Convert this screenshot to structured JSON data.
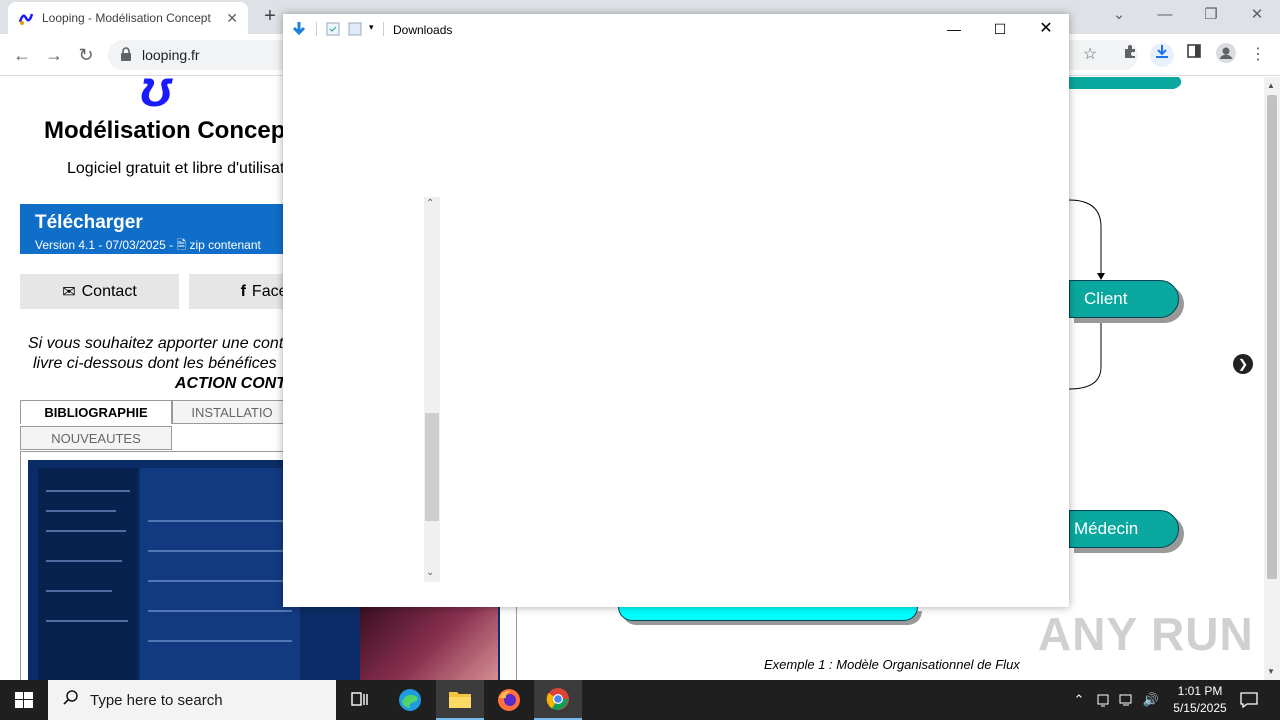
{
  "browser": {
    "tab_title": "Looping - Modélisation Concept",
    "tab_close": "✕",
    "new_tab": "+",
    "url": "looping.fr",
    "controls": {
      "collapse": "⌄",
      "minimize": "—",
      "restore": "❐",
      "close": "✕"
    }
  },
  "page": {
    "title": "Modélisation Concep",
    "subtitle": "Logiciel gratuit et libre d'utilisati",
    "download": {
      "heading": "Télécharger",
      "version_line": "Version 4.1  -  07/03/2025  -",
      "zip_text": "zip contenant"
    },
    "buttons": {
      "contact": "Contact",
      "facebook": "Faceb"
    },
    "contribution": {
      "line1": "Si vous souhaitez apporter une cont",
      "line2": "livre ci-dessous dont les bénéfices",
      "line3": "ACTION CONT"
    },
    "tabs": {
      "bibliographie": "BIBLIOGRAPHIE",
      "installation": "INSTALLATIO",
      "nouveautes": "NOUVEAUTES"
    },
    "diagram": {
      "nodes": [
        "Client",
        "Médecin"
      ],
      "caption": "Exemple 1 : Modèle Organisationnel de Flux"
    },
    "watermark": "ANY RUN"
  },
  "explorer": {
    "title": "Downloads",
    "controls": {
      "minimize": "—",
      "maximize": "☐",
      "close": "✕"
    }
  },
  "taskbar": {
    "search_placeholder": "Type here to search",
    "time": "1:01 PM",
    "date": "5/15/2025"
  }
}
